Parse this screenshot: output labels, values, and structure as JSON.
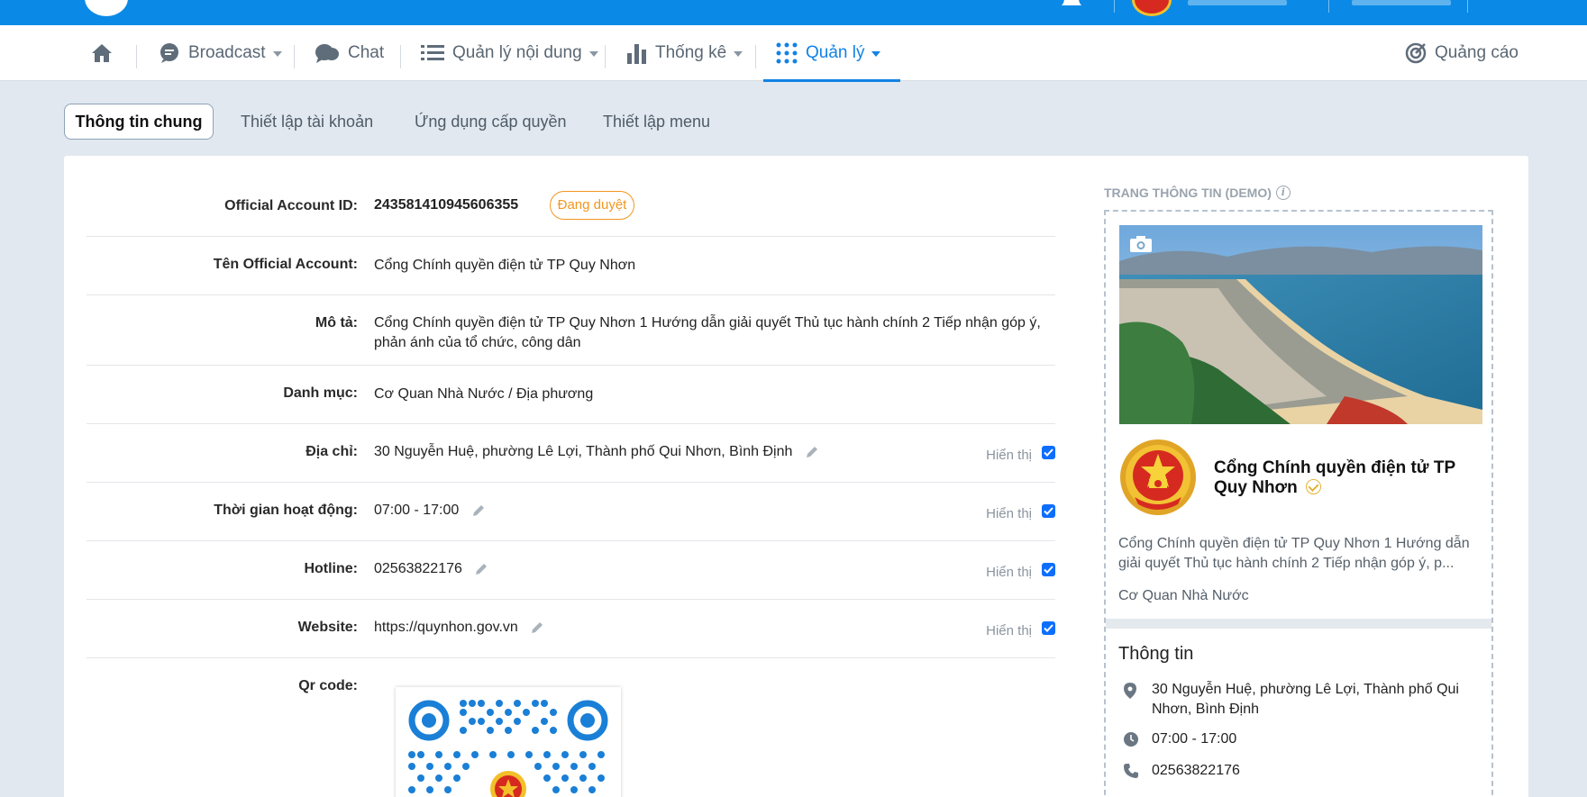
{
  "nav": {
    "broadcast": "Broadcast",
    "chat": "Chat",
    "content": "Quản lý nội dung",
    "stats": "Thống kê",
    "manage": "Quản lý",
    "ads": "Quảng cáo"
  },
  "tabs": {
    "general": "Thông tin chung",
    "account": "Thiết lập tài khoản",
    "apps": "Ứng dụng cấp quyền",
    "menu": "Thiết lập menu"
  },
  "form": {
    "oa_id_label": "Official Account ID:",
    "oa_id": "243581410945606355",
    "status": "Đang duyệt",
    "name_label": "Tên Official Account:",
    "name": "Cổng Chính quyền điện tử TP Quy Nhơn",
    "desc_label": "Mô tả:",
    "desc": "Cổng Chính quyền điện tử TP Quy Nhơn 1 Hướng dẫn giải quyết Thủ tục hành chính 2 Tiếp nhận góp ý, phản ánh của tổ chức, công dân",
    "category_label": "Danh mục:",
    "category": "Cơ Quan Nhà Nước / Địa phương",
    "address_label": "Địa chỉ:",
    "address": "30 Nguyễn Huệ, phường Lê Lợi, Thành phố Qui Nhơn, Bình Định",
    "hours_label": "Thời gian hoạt động:",
    "hours": "07:00 - 17:00",
    "hotline_label": "Hotline:",
    "hotline": "02563822176",
    "website_label": "Website:",
    "website": "https://quynhon.gov.vn",
    "qr_label": "Qr code:",
    "show_label": "Hiển thị"
  },
  "demo": {
    "title": "TRANG THÔNG TIN (DEMO)",
    "name": "Cổng Chính quyền điện tử TP Quy Nhơn",
    "desc": "Cổng Chính quyền điện tử TP Quy Nhơn 1 Hướng dẫn giải quyết Thủ tục hành chính 2 Tiếp nhận góp ý, p...",
    "category": "Cơ Quan Nhà Nước",
    "info_title": "Thông tin",
    "address": "30 Nguyễn Huệ, phường Lê Lợi, Thành phố Qui Nhơn, Bình Định",
    "hours": "07:00 - 17:00",
    "hotline": "02563822176"
  },
  "colors": {
    "brand_blue": "#0a8ae6",
    "active_blue": "#1282e6",
    "pending_orange": "#f3961e",
    "page_bg": "#e1e8ef"
  }
}
